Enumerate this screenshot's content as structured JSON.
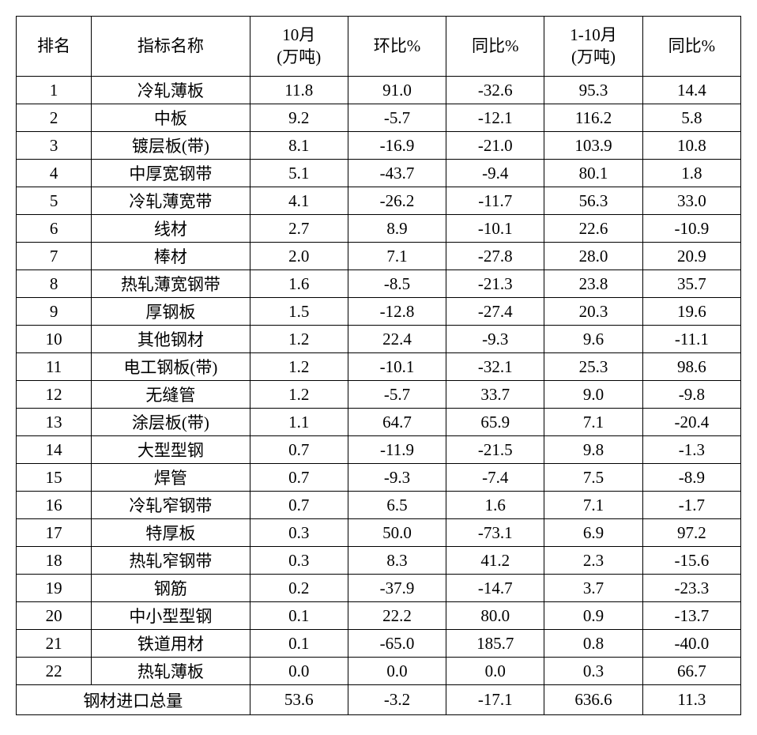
{
  "chart_data": {
    "type": "table",
    "headers": {
      "rank": "排名",
      "name": "指标名称",
      "oct": "10月\n(万吨)",
      "mom": "环比%",
      "yoy": "同比%",
      "jan_oct": "1-10月\n(万吨)",
      "yoy_cum": "同比%"
    },
    "rows": [
      {
        "rank": "1",
        "name": "冷轧薄板",
        "oct": "11.8",
        "mom": "91.0",
        "yoy": "-32.6",
        "jan_oct": "95.3",
        "yoy_cum": "14.4"
      },
      {
        "rank": "2",
        "name": "中板",
        "oct": "9.2",
        "mom": "-5.7",
        "yoy": "-12.1",
        "jan_oct": "116.2",
        "yoy_cum": "5.8"
      },
      {
        "rank": "3",
        "name": "镀层板(带)",
        "oct": "8.1",
        "mom": "-16.9",
        "yoy": "-21.0",
        "jan_oct": "103.9",
        "yoy_cum": "10.8"
      },
      {
        "rank": "4",
        "name": "中厚宽钢带",
        "oct": "5.1",
        "mom": "-43.7",
        "yoy": "-9.4",
        "jan_oct": "80.1",
        "yoy_cum": "1.8"
      },
      {
        "rank": "5",
        "name": "冷轧薄宽带",
        "oct": "4.1",
        "mom": "-26.2",
        "yoy": "-11.7",
        "jan_oct": "56.3",
        "yoy_cum": "33.0"
      },
      {
        "rank": "6",
        "name": "线材",
        "oct": "2.7",
        "mom": "8.9",
        "yoy": "-10.1",
        "jan_oct": "22.6",
        "yoy_cum": "-10.9"
      },
      {
        "rank": "7",
        "name": "棒材",
        "oct": "2.0",
        "mom": "7.1",
        "yoy": "-27.8",
        "jan_oct": "28.0",
        "yoy_cum": "20.9"
      },
      {
        "rank": "8",
        "name": "热轧薄宽钢带",
        "oct": "1.6",
        "mom": "-8.5",
        "yoy": "-21.3",
        "jan_oct": "23.8",
        "yoy_cum": "35.7"
      },
      {
        "rank": "9",
        "name": "厚钢板",
        "oct": "1.5",
        "mom": "-12.8",
        "yoy": "-27.4",
        "jan_oct": "20.3",
        "yoy_cum": "19.6"
      },
      {
        "rank": "10",
        "name": "其他钢材",
        "oct": "1.2",
        "mom": "22.4",
        "yoy": "-9.3",
        "jan_oct": "9.6",
        "yoy_cum": "-11.1"
      },
      {
        "rank": "11",
        "name": "电工钢板(带)",
        "oct": "1.2",
        "mom": "-10.1",
        "yoy": "-32.1",
        "jan_oct": "25.3",
        "yoy_cum": "98.6"
      },
      {
        "rank": "12",
        "name": "无缝管",
        "oct": "1.2",
        "mom": "-5.7",
        "yoy": "33.7",
        "jan_oct": "9.0",
        "yoy_cum": "-9.8"
      },
      {
        "rank": "13",
        "name": "涂层板(带)",
        "oct": "1.1",
        "mom": "64.7",
        "yoy": "65.9",
        "jan_oct": "7.1",
        "yoy_cum": "-20.4"
      },
      {
        "rank": "14",
        "name": "大型型钢",
        "oct": "0.7",
        "mom": "-11.9",
        "yoy": "-21.5",
        "jan_oct": "9.8",
        "yoy_cum": "-1.3"
      },
      {
        "rank": "15",
        "name": "焊管",
        "oct": "0.7",
        "mom": "-9.3",
        "yoy": "-7.4",
        "jan_oct": "7.5",
        "yoy_cum": "-8.9"
      },
      {
        "rank": "16",
        "name": "冷轧窄钢带",
        "oct": "0.7",
        "mom": "6.5",
        "yoy": "1.6",
        "jan_oct": "7.1",
        "yoy_cum": "-1.7"
      },
      {
        "rank": "17",
        "name": "特厚板",
        "oct": "0.3",
        "mom": "50.0",
        "yoy": "-73.1",
        "jan_oct": "6.9",
        "yoy_cum": "97.2"
      },
      {
        "rank": "18",
        "name": "热轧窄钢带",
        "oct": "0.3",
        "mom": "8.3",
        "yoy": "41.2",
        "jan_oct": "2.3",
        "yoy_cum": "-15.6"
      },
      {
        "rank": "19",
        "name": "钢筋",
        "oct": "0.2",
        "mom": "-37.9",
        "yoy": "-14.7",
        "jan_oct": "3.7",
        "yoy_cum": "-23.3"
      },
      {
        "rank": "20",
        "name": "中小型型钢",
        "oct": "0.1",
        "mom": "22.2",
        "yoy": "80.0",
        "jan_oct": "0.9",
        "yoy_cum": "-13.7"
      },
      {
        "rank": "21",
        "name": "铁道用材",
        "oct": "0.1",
        "mom": "-65.0",
        "yoy": "185.7",
        "jan_oct": "0.8",
        "yoy_cum": "-40.0"
      },
      {
        "rank": "22",
        "name": "热轧薄板",
        "oct": "0.0",
        "mom": "0.0",
        "yoy": "0.0",
        "jan_oct": "0.3",
        "yoy_cum": "66.7"
      }
    ],
    "total": {
      "label": "钢材进口总量",
      "oct": "53.6",
      "mom": "-3.2",
      "yoy": "-17.1",
      "jan_oct": "636.6",
      "yoy_cum": "11.3"
    }
  }
}
